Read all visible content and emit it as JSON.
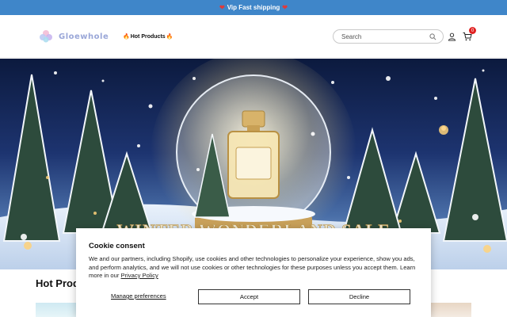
{
  "announcement": {
    "text": "Vip Fast shipping"
  },
  "header": {
    "logo_text": "Gloewhole",
    "nav_hot_products": "Hot Products",
    "search_placeholder": "Search",
    "cart_count": "0"
  },
  "hero": {
    "banner_text": "WINTER WONDERLAND SALE"
  },
  "section": {
    "title": "Hot Products"
  },
  "cookie": {
    "title": "Cookie consent",
    "body": "We and our partners, including Shopify, use cookies and other technologies to personalize your experience, show you ads, and perform analytics, and we will not use cookies or other technologies for these purposes unless you accept them. Learn more in our ",
    "privacy_link": "Privacy Policy",
    "manage_label": "Manage preferences",
    "accept_label": "Accept",
    "decline_label": "Decline"
  },
  "colors": {
    "announcement_bg": "#3f86c9",
    "cart_badge": "#e02020",
    "logo": "#9aa7d8"
  },
  "icons": [
    "heart-icon",
    "fire-icon",
    "search-icon",
    "account-icon",
    "cart-icon"
  ]
}
